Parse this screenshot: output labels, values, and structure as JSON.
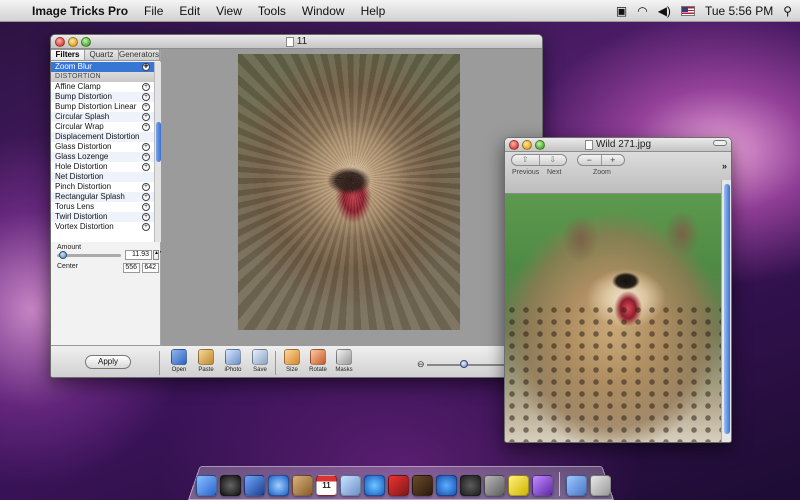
{
  "menubar": {
    "app_name": "Image Tricks Pro",
    "menus": [
      "File",
      "Edit",
      "View",
      "Tools",
      "Window",
      "Help"
    ],
    "clock": "Tue 5:56 PM",
    "icons": [
      "apple-icon",
      "status-icon",
      "wifi-icon",
      "volume-icon",
      "flag-icon",
      "search-icon"
    ]
  },
  "main_window": {
    "title": "11",
    "tabs": [
      "Filters",
      "Quartz",
      "Generators"
    ],
    "selected_filter": "Zoom Blur",
    "category": "DISTORTION",
    "filters": [
      "Affine Clamp",
      "Bump Distortion",
      "Bump Distortion Linear",
      "Circular Splash",
      "Circular Wrap",
      "Displacement Distortion",
      "Glass Distortion",
      "Glass Lozenge",
      "Hole Distortion",
      "Net Distortion",
      "Pinch Distortion",
      "Rectangular Splash",
      "Torus Lens",
      "Twirl Distortion",
      "Vortex Distortion"
    ],
    "params": {
      "amount_label": "Amount",
      "amount_value": "11.93",
      "center_label": "Center",
      "center_x": "556",
      "center_y": "642"
    },
    "apply_label": "Apply",
    "tools": [
      "Open",
      "Paste",
      "iPhoto",
      "Save",
      "Size",
      "Rotate",
      "Masks"
    ]
  },
  "preview_window": {
    "title": "Wild 271.jpg",
    "nav_labels": [
      "Previous",
      "Next"
    ],
    "zoom_label": "Zoom",
    "zoom_minus": "−",
    "zoom_plus": "+",
    "overflow": "»"
  },
  "dock": {
    "calendar_day": "11"
  },
  "colors": {
    "selection": "#3876d6",
    "desktop": "#4b1c66"
  }
}
